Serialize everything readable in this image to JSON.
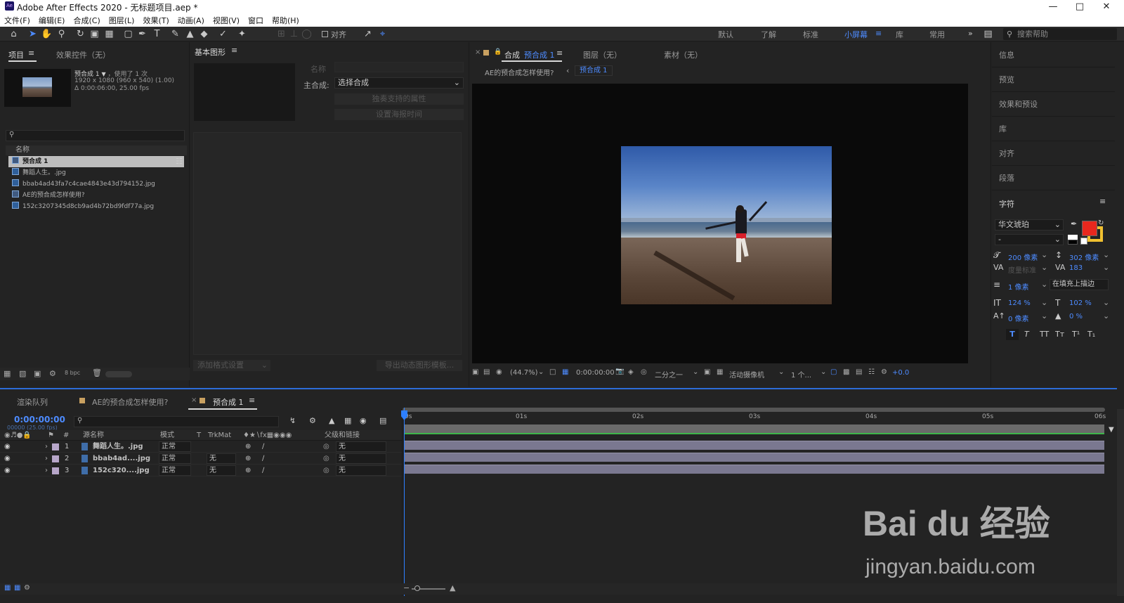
{
  "title": "Adobe After Effects 2020 - 无标题项目.aep *",
  "app_icon": "Ae",
  "menu": [
    "文件(F)",
    "编辑(E)",
    "合成(C)",
    "图层(L)",
    "效果(T)",
    "动画(A)",
    "视图(V)",
    "窗口",
    "帮助(H)"
  ],
  "toolbar": {
    "align_label": "对齐",
    "workspaces": [
      "默认",
      "了解",
      "标准",
      "小屏幕",
      "库",
      "常用"
    ],
    "active_workspace": "小屏幕",
    "help_placeholder": "搜索帮助"
  },
  "project": {
    "tab_project": "项目",
    "tab_effects": "效果控件（无）",
    "item_name": "预合成 1",
    "item_used": "，使用了 1 次",
    "item_dims": "1920 x 1080 (960 x 540) (1.00)",
    "item_duration": "Δ 0:00:06:00, 25.00 fps",
    "col_name": "名称",
    "items": [
      {
        "name": "预合成 1",
        "type": "comp"
      },
      {
        "name": "舞蹈人生。.jpg",
        "type": "image"
      },
      {
        "name": "bbab4ad43fa7c4cae4843e43d794152.jpg",
        "type": "image"
      },
      {
        "name": "AE的预合成怎样使用?",
        "type": "comp"
      },
      {
        "name": "152c3207345d8cb9ad4b72bd9fdf77a.jpg",
        "type": "image"
      }
    ],
    "bpc": "8 bpc"
  },
  "essential": {
    "title": "基本图形",
    "name_label": "名称",
    "master_label": "主合成:",
    "master_value": "选择合成",
    "btn_solo": "独奏支持的属性",
    "btn_poster": "设置海报时间",
    "add_format": "添加格式设置",
    "export_btn": "导出动态图形模板..."
  },
  "comp": {
    "tab_prefix": "合成",
    "tab_name": "预合成 1",
    "tab_layer": "图层（无）",
    "tab_footage": "素材（无）",
    "breadcrumb_parent": "AE的预合成怎样使用?",
    "breadcrumb_current": "预合成 1",
    "zoom": "(44.7%)",
    "timecode": "0:00:00:00",
    "resolution": "二分之一",
    "camera": "活动摄像机",
    "views": "1 个...",
    "exposure": "+0.0"
  },
  "side": {
    "items": [
      "信息",
      "预览",
      "效果和预设",
      "库",
      "对齐",
      "段落"
    ],
    "char_title": "字符",
    "font": "华文琥珀",
    "font_style": "-",
    "size": "200 像素",
    "leading": "302 像素",
    "kerning": "度量标准",
    "tracking": "183",
    "stroke": "1 像素",
    "stroke_mode": "在填充上描边",
    "vscale": "124 %",
    "hscale": "102 %",
    "baseline": "0 像素",
    "tsume": "0 %",
    "fill_color": "#e8281e",
    "stroke_color": "#f0c030"
  },
  "timeline": {
    "tab_render": "渲染队列",
    "tab_comp1": "AE的预合成怎样使用?",
    "tab_comp2": "预合成 1",
    "timecode": "0:00:00:00",
    "frames": "00000 (25.00 fps)",
    "col_source": "源名称",
    "col_mode": "模式",
    "col_t": "T",
    "col_trkmat": "TrkMat",
    "col_parent": "父级和链接",
    "ruler": [
      "0s",
      "01s",
      "02s",
      "03s",
      "04s",
      "05s",
      "06s"
    ],
    "layers": [
      {
        "num": "1",
        "name": "舞蹈人生。.jpg",
        "mode": "正常",
        "trkmat": "",
        "parent": "无"
      },
      {
        "num": "2",
        "name": "bbab4ad....jpg",
        "mode": "正常",
        "trkmat": "无",
        "parent": "无"
      },
      {
        "num": "3",
        "name": "152c320....jpg",
        "mode": "正常",
        "trkmat": "无",
        "parent": "无"
      }
    ]
  },
  "watermark": {
    "text": "Bai du 经验",
    "url": "jingyan.baidu.com"
  }
}
